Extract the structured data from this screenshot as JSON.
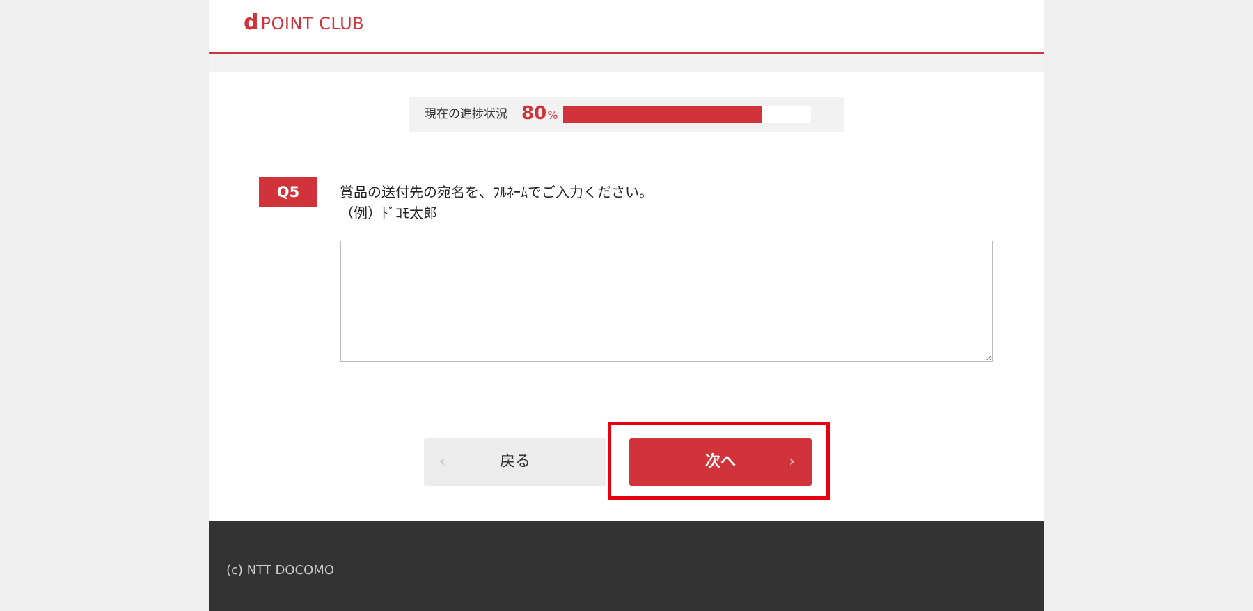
{
  "brand": {
    "logo_mark": "d",
    "logo_text": "POINT CLUB",
    "accent_color": "#d0333a"
  },
  "progress": {
    "label": "現在の進捗状況",
    "percent_value": "80",
    "percent_unit": "%",
    "fraction": 0.8
  },
  "question": {
    "number": "Q5",
    "prompt": "賞品の送付先の宛名を、ﾌﾙﾈｰﾑでご入力ください。",
    "example": "（例）ﾄﾞｺﾓ太郎",
    "answer_value": ""
  },
  "navigation": {
    "back_label": "戻る",
    "back_icon": "chevron-left-icon",
    "next_label": "次へ",
    "next_icon": "chevron-right-icon"
  },
  "footer": {
    "copyright": "(c) NTT DOCOMO"
  }
}
